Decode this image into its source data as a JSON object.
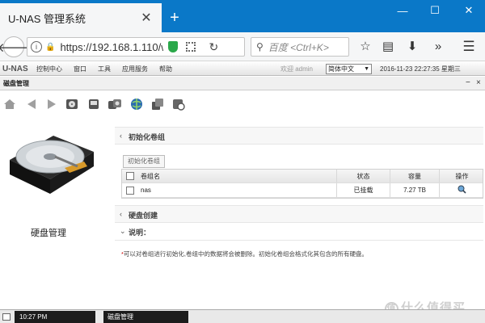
{
  "browser": {
    "tab_title": "U-NAS 管理系统",
    "tab_close": "✕",
    "new_tab": "+",
    "url": "https://192.168.1.110/w",
    "search_placeholder": "百度 <Ctrl+K>",
    "window_controls": [
      "—",
      "☐",
      "✕"
    ]
  },
  "app": {
    "logo": "U-NAS",
    "menu": [
      "控制中心",
      "窗口",
      "工具",
      "应用服务",
      "帮助"
    ],
    "welcome": "欢迎 admin",
    "language": "简体中文",
    "datetime": "2016-11-23 22:27:35 星期三"
  },
  "panel": {
    "title": "磁盘管理",
    "caption": "硬盘管理"
  },
  "sections": {
    "volume_init": "初始化卷组",
    "disk_create": "硬盘创建",
    "notes": "说明："
  },
  "init_button": "初始化卷组",
  "table": {
    "headers": {
      "name": "卷组名",
      "status": "状态",
      "capacity": "容量",
      "operation": "操作"
    },
    "rows": [
      {
        "name": "nas",
        "status": "已挂载",
        "capacity": "7.27 TB"
      }
    ]
  },
  "note_text": "可以对卷组进行初始化,卷组中的数据将会被删除。初始化卷组会格式化其包含的所有硬盘。",
  "note_mark": "*",
  "taskbar": {
    "clock": "10:27 PM",
    "task": "磁盘管理"
  },
  "watermark": {
    "badge": "值",
    "text": "什么值得买"
  },
  "colors": {
    "tab_bar": "#0a78c8",
    "shield": "#2aa84a",
    "taskbar_item": "#1c1c1c"
  }
}
